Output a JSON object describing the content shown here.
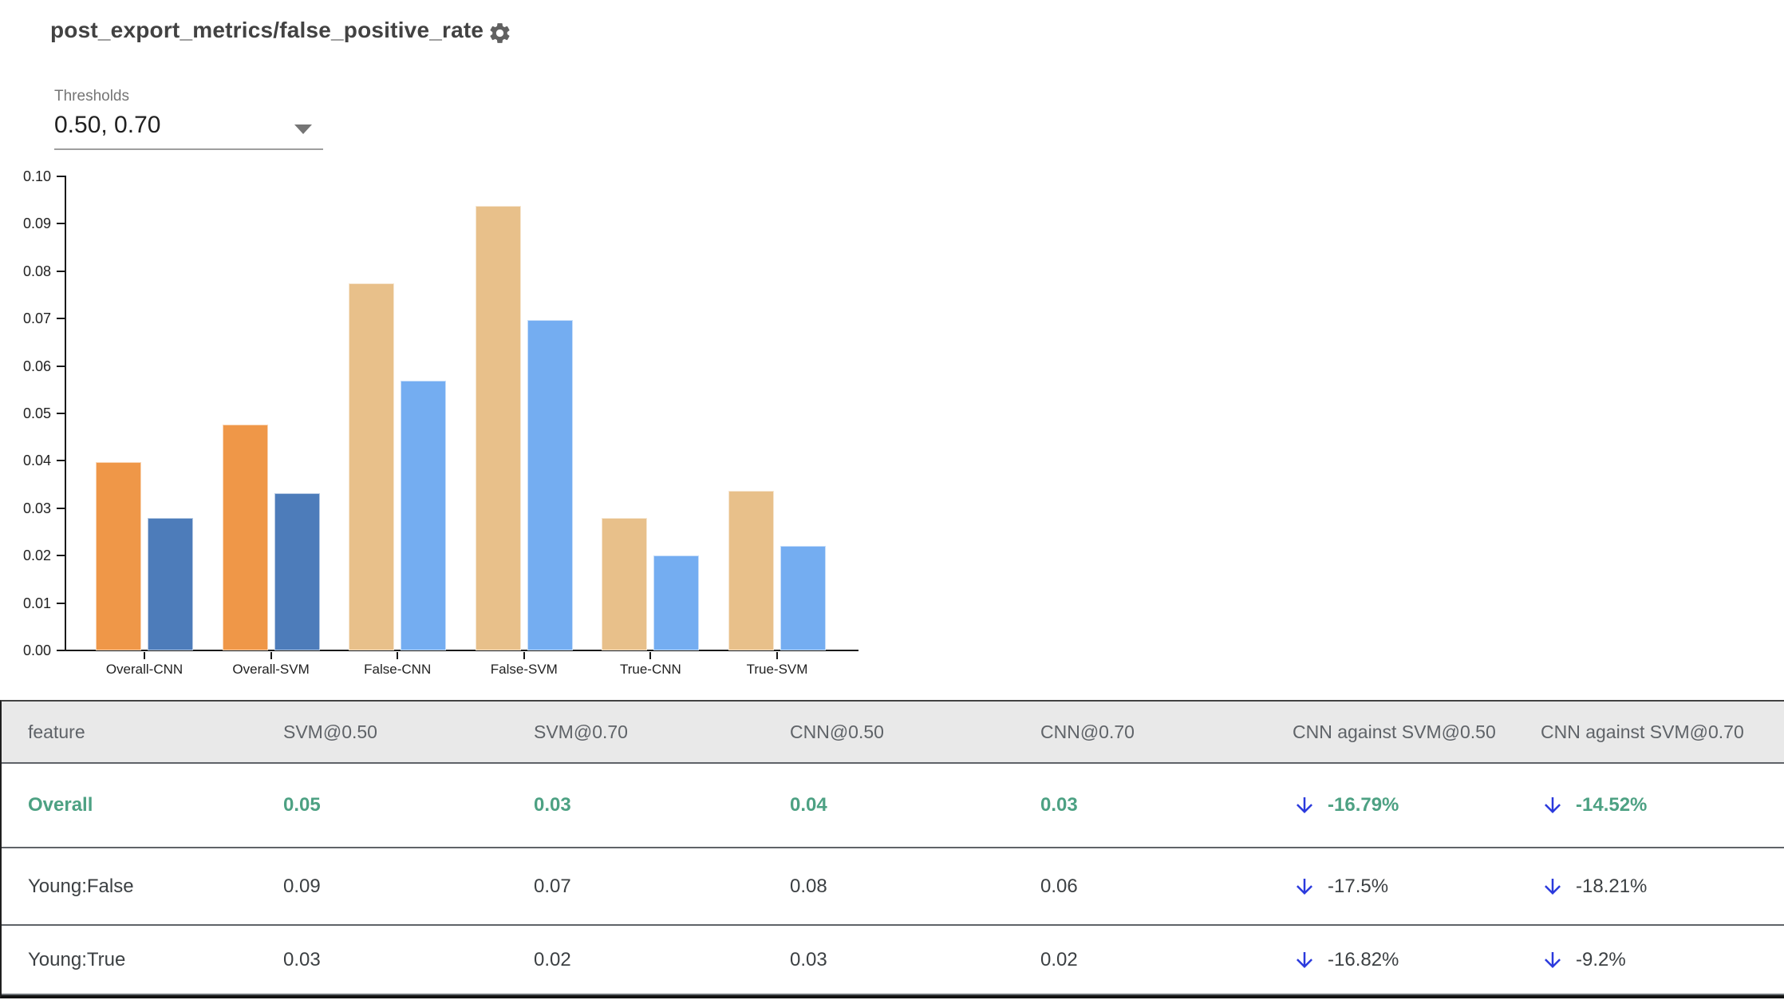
{
  "header": {
    "title": "post_export_metrics/false_positive_rate",
    "settings_icon": "gear-icon"
  },
  "controls": {
    "thresholds_label": "Thresholds",
    "thresholds_value": "0.50, 0.70",
    "dropdown_icon": "chevron-down-icon"
  },
  "colors": {
    "bar_highlight": [
      "#ef9748",
      "#4d7cba"
    ],
    "bar_normal": [
      "#e8c08a",
      "#74adf1"
    ],
    "highlight_text_green": "#4da183",
    "arrow_blue": "#2b3add",
    "header_text": "#5f6368",
    "cell_text": "#3c4043",
    "header_bg": "#e9e9e9",
    "axis_color": "#1a1a1a"
  },
  "chart_data": {
    "type": "bar",
    "title": "post_export_metrics/false_positive_rate",
    "categories": [
      "Overall-CNN",
      "Overall-SVM",
      "False-CNN",
      "False-SVM",
      "True-CNN",
      "True-SVM"
    ],
    "series": [
      {
        "name": "threshold 0.50",
        "values": [
          0.0397,
          0.0477,
          0.0775,
          0.0937,
          0.0279,
          0.0337
        ]
      },
      {
        "name": "threshold 0.70",
        "values": [
          0.028,
          0.0332,
          0.0569,
          0.0697,
          0.02,
          0.022
        ]
      }
    ],
    "xlabel": "",
    "ylabel": "",
    "ylim": [
      0,
      0.1
    ],
    "yticks": [
      "0.10",
      "0.09",
      "0.08",
      "0.07",
      "0.06",
      "0.05",
      "0.04",
      "0.03",
      "0.02",
      "0.01",
      "0.00"
    ],
    "grid": false,
    "legend": "none",
    "highlighted_categories": [
      "Overall-CNN",
      "Overall-SVM"
    ]
  },
  "table": {
    "columns": [
      "feature",
      "SVM@0.50",
      "SVM@0.70",
      "CNN@0.50",
      "CNN@0.70",
      "CNN against SVM@0.50",
      "CNN against SVM@0.70"
    ],
    "rows": [
      {
        "feature": "Overall",
        "values": [
          "0.05",
          "0.03",
          "0.04",
          "0.03"
        ],
        "deltas": [
          "-16.79%",
          "-14.52%"
        ],
        "delta_direction": [
          "down",
          "down"
        ],
        "highlight": true
      },
      {
        "feature": "Young:False",
        "values": [
          "0.09",
          "0.07",
          "0.08",
          "0.06"
        ],
        "deltas": [
          "-17.5%",
          "-18.21%"
        ],
        "delta_direction": [
          "down",
          "down"
        ],
        "highlight": false
      },
      {
        "feature": "Young:True",
        "values": [
          "0.03",
          "0.02",
          "0.03",
          "0.02"
        ],
        "deltas": [
          "-16.82%",
          "-9.2%"
        ],
        "delta_direction": [
          "down",
          "down"
        ],
        "highlight": false
      }
    ]
  }
}
